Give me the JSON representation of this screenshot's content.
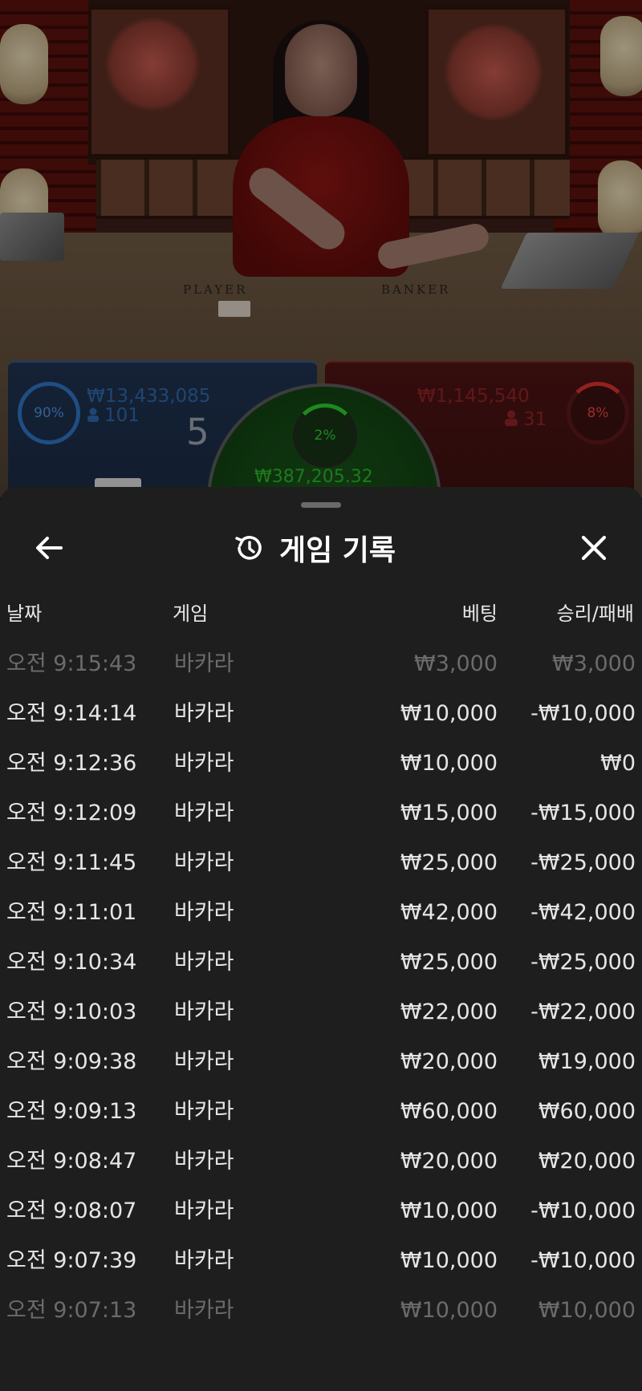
{
  "live": {
    "table_labels": {
      "player": "PLAYER",
      "banker": "BANKER"
    },
    "player": {
      "percent": "90%",
      "amount": "₩13,433,085",
      "count": "101",
      "score": "5"
    },
    "banker": {
      "percent": "8%",
      "amount": "₩1,145,540",
      "count": "31"
    },
    "tie": {
      "percent": "2%",
      "amount": "₩387,205.32"
    }
  },
  "sheet": {
    "title": "게임 기록",
    "columns": {
      "date": "날짜",
      "game": "게임",
      "bet": "베팅",
      "win_loss": "승리/패배"
    },
    "rows": [
      {
        "time": "오전 9:15:43",
        "game": "바카라",
        "bet": "₩3,000",
        "result": "₩3,000"
      },
      {
        "time": "오전 9:14:14",
        "game": "바카라",
        "bet": "₩10,000",
        "result": "-₩10,000"
      },
      {
        "time": "오전 9:12:36",
        "game": "바카라",
        "bet": "₩10,000",
        "result": "₩0"
      },
      {
        "time": "오전 9:12:09",
        "game": "바카라",
        "bet": "₩15,000",
        "result": "-₩15,000"
      },
      {
        "time": "오전 9:11:45",
        "game": "바카라",
        "bet": "₩25,000",
        "result": "-₩25,000"
      },
      {
        "time": "오전 9:11:01",
        "game": "바카라",
        "bet": "₩42,000",
        "result": "-₩42,000"
      },
      {
        "time": "오전 9:10:34",
        "game": "바카라",
        "bet": "₩25,000",
        "result": "-₩25,000"
      },
      {
        "time": "오전 9:10:03",
        "game": "바카라",
        "bet": "₩22,000",
        "result": "-₩22,000"
      },
      {
        "time": "오전 9:09:38",
        "game": "바카라",
        "bet": "₩20,000",
        "result": "₩19,000"
      },
      {
        "time": "오전 9:09:13",
        "game": "바카라",
        "bet": "₩60,000",
        "result": "₩60,000"
      },
      {
        "time": "오전 9:08:47",
        "game": "바카라",
        "bet": "₩20,000",
        "result": "₩20,000"
      },
      {
        "time": "오전 9:08:07",
        "game": "바카라",
        "bet": "₩10,000",
        "result": "-₩10,000"
      },
      {
        "time": "오전 9:07:39",
        "game": "바카라",
        "bet": "₩10,000",
        "result": "-₩10,000"
      },
      {
        "time": "오전 9:07:13",
        "game": "바카라",
        "bet": "₩10,000",
        "result": "₩10,000"
      }
    ],
    "faded_rows": [
      0,
      13
    ]
  },
  "icons": {
    "back": "arrow-left-icon",
    "history": "history-clock-icon",
    "close": "close-icon",
    "person": "person-icon"
  },
  "colors": {
    "player_blue": "#2e73c2",
    "banker_red": "#d93030",
    "tie_green": "#2ecb2e",
    "sheet_bg": "#1e1e1e"
  }
}
